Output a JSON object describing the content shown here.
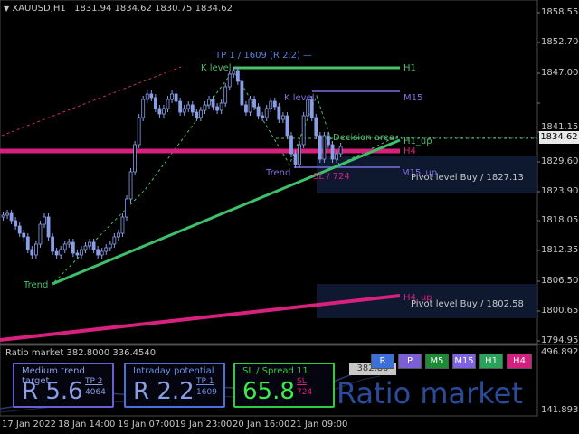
{
  "header": {
    "symbol": "XAUUSD,H1",
    "ohlc": "1831.94 1834.62 1830.75 1834.62"
  },
  "price_axis": {
    "ticks": [
      "1858.55",
      "1852.70",
      "1847.00",
      "1841.15",
      "1835.45",
      "1829.60",
      "1823.90",
      "1818.05",
      "1812.35",
      "1806.50",
      "1800.65",
      "1794.95"
    ],
    "current_price": "1834.62"
  },
  "indicator_axis": {
    "ticks": [
      "496.8926",
      "141.8935"
    ],
    "value_box": "382.80"
  },
  "time_axis": {
    "ticks": [
      "17 Jan 2022",
      "18 Jan 14:00",
      "19 Jan 07:00",
      "19 Jan 23:00",
      "20 Jan 16:00",
      "21 Jan 09:00"
    ]
  },
  "annotations": {
    "tp_label": "TP 1 / 1609 (R 2.2) —",
    "k_level_h1": "K level",
    "k_level_m15": "K level",
    "h1_label": "H1",
    "m15_label": "M15",
    "decision_area": "Decision area",
    "h1_up": "H1_up",
    "h4_label": "H4",
    "trend_upper": "Trend",
    "sl_label": "SL / 724",
    "m15_up": "M15_up",
    "pivot_buy_1": "Pivot level Buy / 1827.13",
    "trend_lower": "Trend",
    "h4_up": "H4_up",
    "pivot_buy_2": "Pivot level Buy / 1802.58"
  },
  "ratio_panel": {
    "title": "Ratio market 382.8000 336.4540",
    "watermark": "Ratio market",
    "medium": {
      "title": "Medium trend target",
      "value": "R 5.6",
      "sub_top": "TP 2",
      "sub_bottom": "4064"
    },
    "intraday": {
      "title": "Intraday potential",
      "value": "R 2.2",
      "sub_top": "TP 1",
      "sub_bottom": "1609"
    },
    "sl_spread": {
      "title": "SL / Spread 11",
      "value": "65.8",
      "sub_top": "SL",
      "sub_bottom": "724"
    }
  },
  "timeframe_buttons": [
    {
      "label": "R",
      "color": "#3d6fd8"
    },
    {
      "label": "P",
      "color": "#7b5fd6"
    },
    {
      "label": "M5",
      "color": "#1e8a35"
    },
    {
      "label": "M15",
      "color": "#7e63e0"
    },
    {
      "label": "H1",
      "color": "#2aa35a"
    },
    {
      "label": "H4",
      "color": "#d4207e"
    }
  ],
  "colors": {
    "bull_candle": "#8a9ee8",
    "h1_line": "#4cbf6a",
    "h4_line": "#d8207e",
    "m15_line": "#7f6fe0",
    "trend_line": "#3fbf6a",
    "tp_text": "#5b7fe0"
  }
}
